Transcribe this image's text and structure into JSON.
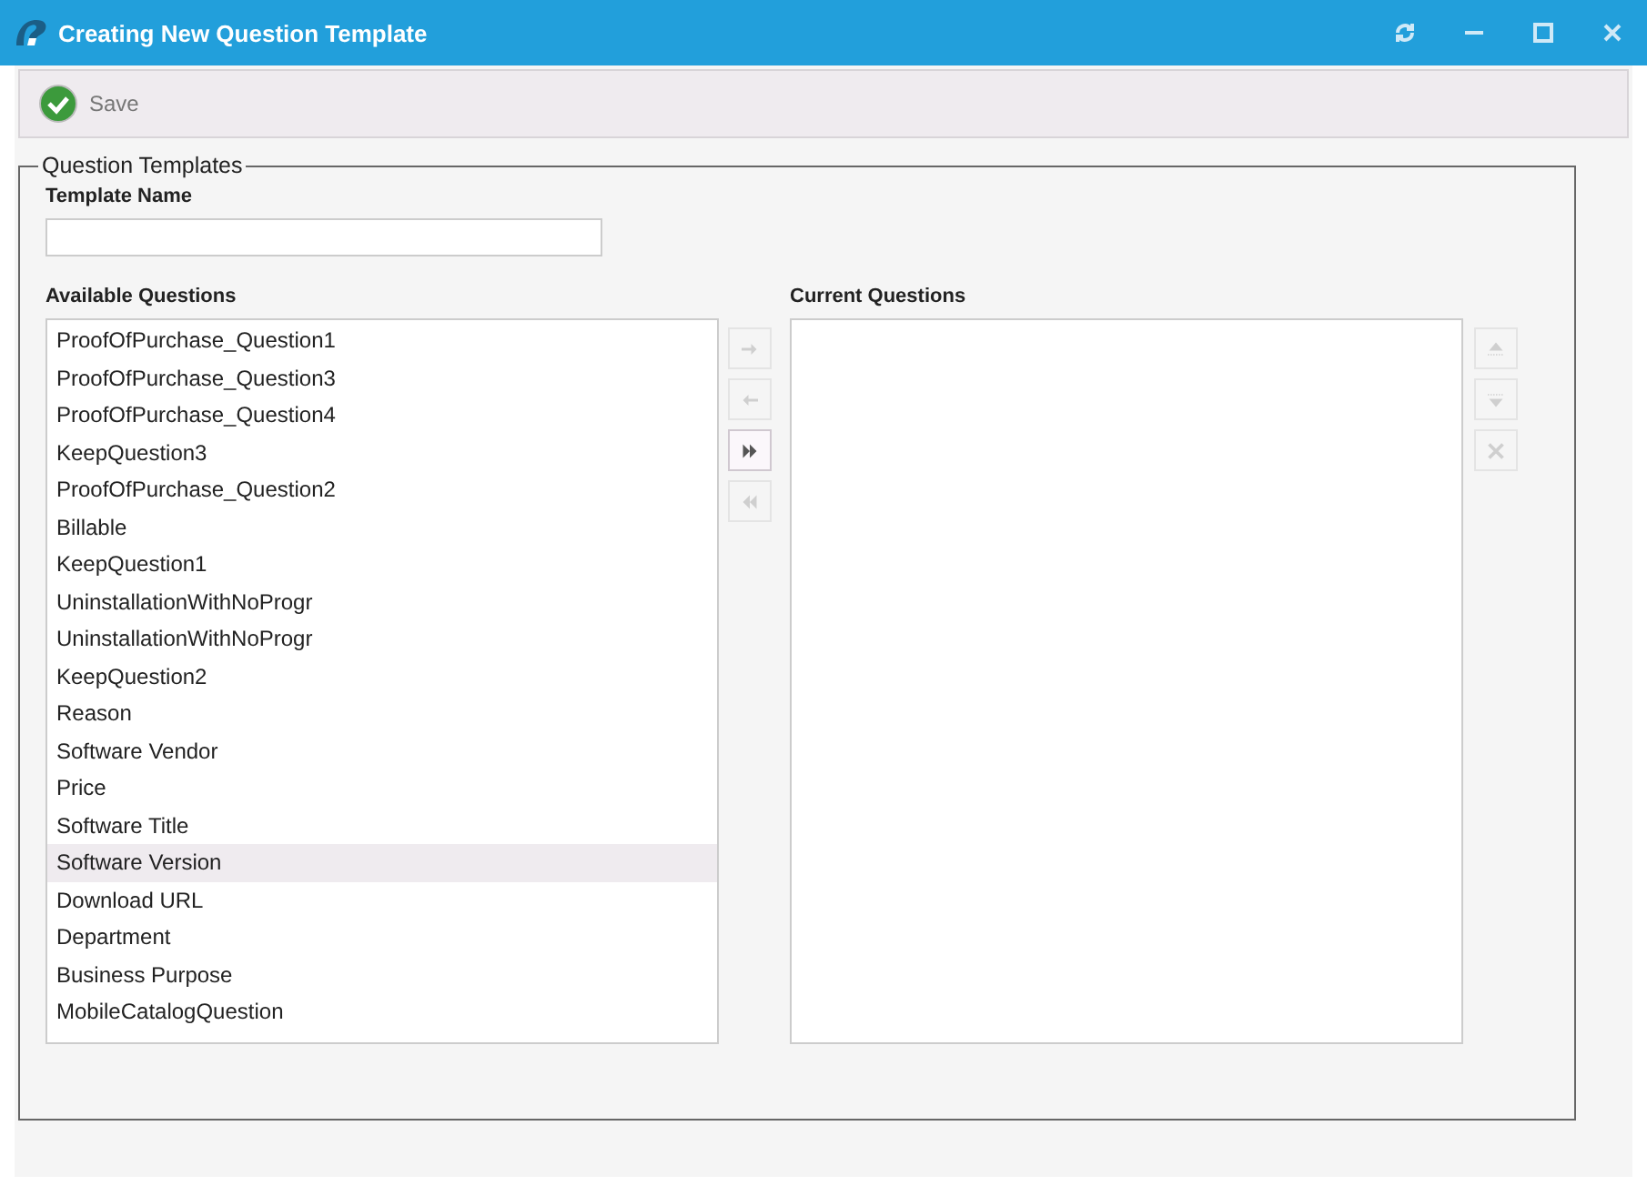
{
  "window": {
    "title": "Creating New Question Template"
  },
  "toolbar": {
    "save": {
      "label": "Save",
      "disabled": true
    }
  },
  "group": {
    "title": "Question Templates",
    "template_name": {
      "label": "Template Name"
    },
    "available": {
      "label": "Available Questions",
      "items": [
        {
          "text": "ProofOfPurchase_Question1",
          "selected": false
        },
        {
          "text": "ProofOfPurchase_Question3",
          "selected": false
        },
        {
          "text": "ProofOfPurchase_Question4",
          "selected": false
        },
        {
          "text": "KeepQuestion3",
          "selected": false
        },
        {
          "text": "ProofOfPurchase_Question2",
          "selected": false
        },
        {
          "text": "Billable",
          "selected": false
        },
        {
          "text": "KeepQuestion1",
          "selected": false
        },
        {
          "text": "UninstallationWithNoProgr",
          "selected": false
        },
        {
          "text": "UninstallationWithNoProgr",
          "selected": false
        },
        {
          "text": "KeepQuestion2",
          "selected": false
        },
        {
          "text": "Reason",
          "selected": false
        },
        {
          "text": "Software Vendor",
          "selected": false
        },
        {
          "text": "Price",
          "selected": false
        },
        {
          "text": "Software Title",
          "selected": false
        },
        {
          "text": "Software Version",
          "selected": true
        },
        {
          "text": "Download URL",
          "selected": false
        },
        {
          "text": "Department",
          "selected": false
        },
        {
          "text": "Business Purpose",
          "selected": false
        },
        {
          "text": "MobileCatalogQuestion",
          "selected": false
        }
      ]
    },
    "move_buttons": [
      {
        "kind": "add",
        "disabled": true
      },
      {
        "kind": "remove",
        "disabled": true
      },
      {
        "kind": "add_all",
        "disabled": false
      },
      {
        "kind": "remove_all",
        "disabled": true
      }
    ],
    "current": {
      "label": "Current Questions"
    },
    "order_buttons": [
      {
        "kind": "up",
        "disabled": true
      },
      {
        "kind": "down",
        "disabled": true
      },
      {
        "kind": "delete",
        "disabled": true
      }
    ]
  }
}
